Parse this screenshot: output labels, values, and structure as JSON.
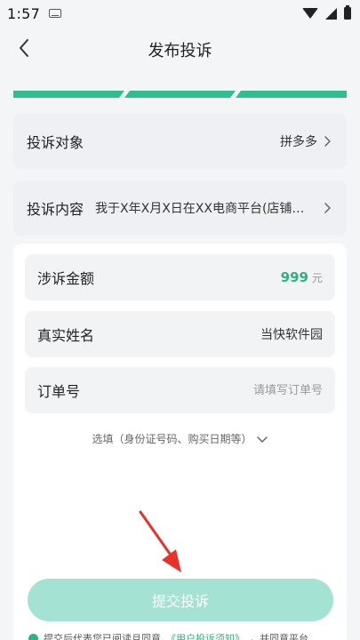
{
  "status_bar": {
    "time": "1:57"
  },
  "header": {
    "title": "发布投诉"
  },
  "complaint_target": {
    "label": "投诉对象",
    "value": "拼多多"
  },
  "complaint_content": {
    "label": "投诉内容",
    "value": "我于X年X月X日在XX电商平台(店铺…"
  },
  "form": {
    "amount": {
      "label": "涉诉金额",
      "value": "999",
      "unit": "元"
    },
    "real_name": {
      "label": "真实姓名",
      "value": "当快软件园"
    },
    "order_no": {
      "label": "订单号",
      "value": "",
      "placeholder": "请填写订单号"
    },
    "optional_toggle": "选填（身份证号码、购买日期等）"
  },
  "submit": {
    "label": "提交投诉"
  },
  "agreement": {
    "prefix": "提交后代表您已阅读且同意",
    "link": "《用户投诉须知》",
    "suffix": "，并同意平台"
  },
  "colors": {
    "accent": "#2db37e",
    "button": "#a4e2d4",
    "annotation": "#e8322a"
  }
}
